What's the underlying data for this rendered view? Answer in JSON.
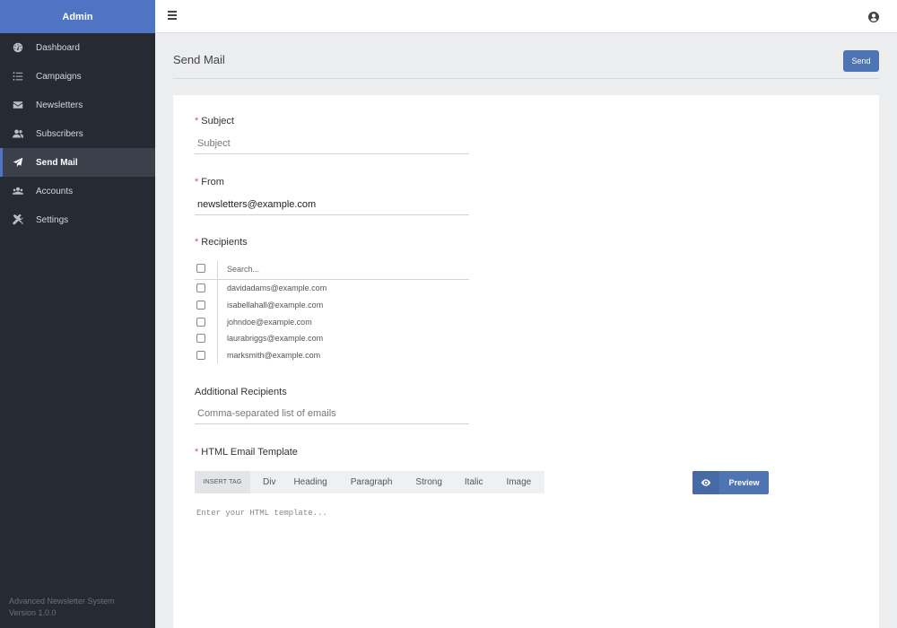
{
  "sidebar": {
    "brand": "Admin",
    "items": [
      {
        "label": "Dashboard",
        "icon": "dashboard-icon"
      },
      {
        "label": "Campaigns",
        "icon": "list-icon"
      },
      {
        "label": "Newsletters",
        "icon": "envelope-icon"
      },
      {
        "label": "Subscribers",
        "icon": "users-icon"
      },
      {
        "label": "Send Mail",
        "icon": "paper-plane-icon",
        "active": true
      },
      {
        "label": "Accounts",
        "icon": "accounts-icon"
      },
      {
        "label": "Settings",
        "icon": "tools-icon"
      }
    ],
    "footer_name": "Advanced Newsletter System",
    "footer_version": "Version 1.0.0"
  },
  "topbar": {
    "menu_icon": "hamburger-icon",
    "user_icon": "user-circle-icon"
  },
  "page": {
    "title": "Send Mail",
    "send_label": "Send"
  },
  "form": {
    "subject_label": "Subject",
    "subject_placeholder": "Subject",
    "from_label": "From",
    "from_value": "newsletters@example.com",
    "recipients_label": "Recipients",
    "recipients_search_placeholder": "Search...",
    "recipients": [
      "davidadams@example.com",
      "isabellahall@example.com",
      "johndoe@example.com",
      "laurabriggs@example.com",
      "marksmith@example.com"
    ],
    "additional_label": "Additional Recipients",
    "additional_placeholder": "Comma-separated list of emails",
    "template_label": "HTML Email Template",
    "toolbar": {
      "insert_tag": "INSERT TAG",
      "tags": [
        "Div",
        "Heading",
        "Paragraph",
        "Strong",
        "Italic",
        "Image"
      ]
    },
    "preview_label": "Preview",
    "template_placeholder": "Enter your HTML template..."
  },
  "colors": {
    "brand": "#4f74c4",
    "sidebar_bg": "#262a33",
    "button": "#4f74b3",
    "required": "#d9534f"
  }
}
